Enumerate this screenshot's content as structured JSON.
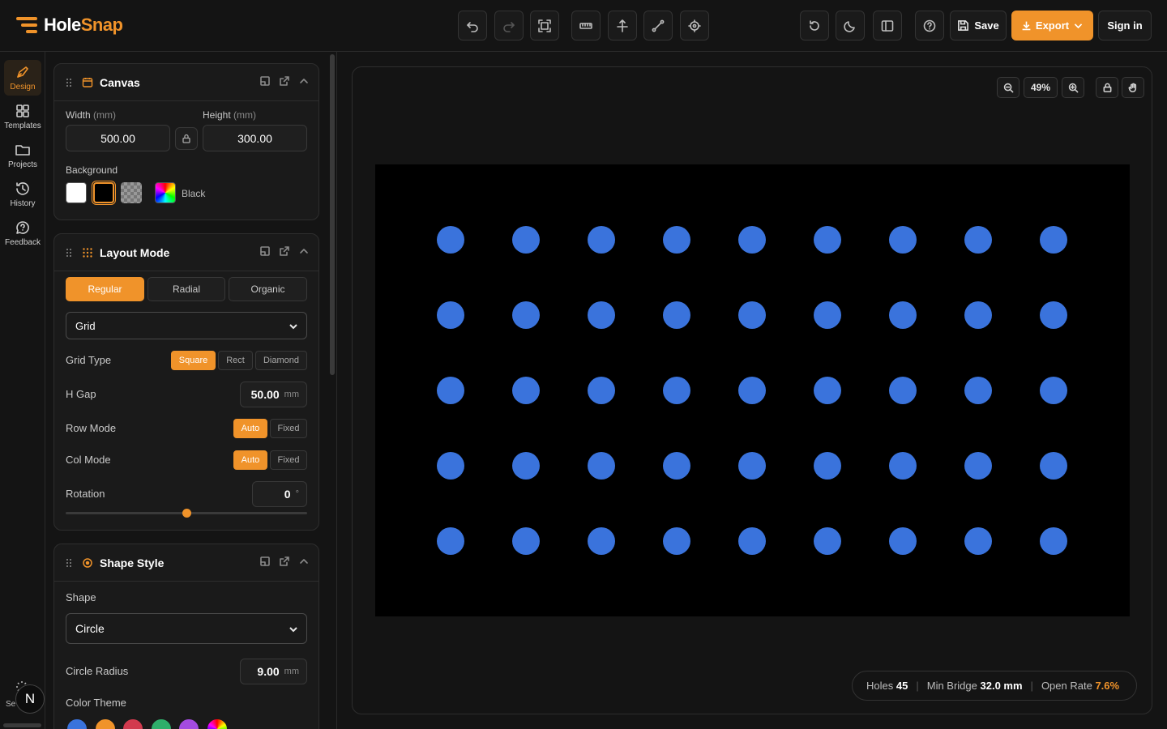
{
  "app": {
    "name_main": "Hole",
    "name_accent": "Snap"
  },
  "colors": {
    "accent": "#f0932a",
    "hole": "#3a73dc",
    "background": "#000000"
  },
  "toolbar": {
    "tools": [
      "undo-icon",
      "redo-icon",
      "fit-icon",
      "ruler-icon",
      "align-icon",
      "measure-icon",
      "target-icon",
      "reset-icon",
      "moon-icon",
      "sidebar-icon",
      "help-icon"
    ],
    "save_label": "Save",
    "export_label": "Export",
    "signin_label": "Sign in"
  },
  "nav": {
    "items": [
      {
        "label": "Design",
        "icon": "pen-icon",
        "active": true
      },
      {
        "label": "Templates",
        "icon": "grid-icon"
      },
      {
        "label": "Projects",
        "icon": "folder-icon"
      },
      {
        "label": "History",
        "icon": "history-icon"
      },
      {
        "label": "Feedback",
        "icon": "chat-icon"
      }
    ],
    "settings_label": "Se",
    "avatar_letter": "N"
  },
  "canvas_panel": {
    "title": "Canvas",
    "width_label": "Width",
    "width_unit": "(mm)",
    "width_value": "500.00",
    "height_label": "Height",
    "height_unit": "(mm)",
    "height_value": "300.00",
    "background_label": "Background",
    "background_value": "Black"
  },
  "layout_panel": {
    "title": "Layout Mode",
    "modes": [
      "Regular",
      "Radial",
      "Organic"
    ],
    "active_mode": "Regular",
    "pattern": "Grid",
    "grid_type_label": "Grid Type",
    "grid_types": [
      "Square",
      "Rect",
      "Diamond"
    ],
    "h_gap_label": "H Gap",
    "h_gap_value": "50.00",
    "h_gap_unit": "mm",
    "row_mode_label": "Row Mode",
    "col_mode_label": "Col Mode",
    "mode_options": [
      "Auto",
      "Fixed"
    ],
    "rotation_label": "Rotation",
    "rotation_value": "0",
    "rotation_unit": "°",
    "rotation_slider_fraction": 0.5
  },
  "shape_panel": {
    "title": "Shape Style",
    "shape_label": "Shape",
    "shape_value": "Circle",
    "radius_label": "Circle Radius",
    "radius_value": "9.00",
    "radius_unit": "mm",
    "color_theme_label": "Color Theme",
    "theme_colors": [
      "#3a73dc",
      "#f0932a",
      "#d23a4e",
      "#2fae6a",
      "#a44be0",
      "rainbow"
    ]
  },
  "stage": {
    "zoom": "49%",
    "grid_rows": 5,
    "grid_cols": 9
  },
  "stats": {
    "holes_label": "Holes",
    "holes_value": "45",
    "bridge_label": "Min Bridge",
    "bridge_value": "32.0 mm",
    "open_label": "Open Rate",
    "open_value": "7.6%"
  }
}
